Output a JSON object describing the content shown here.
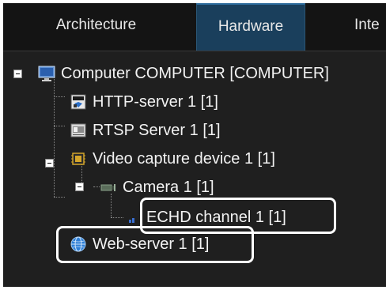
{
  "tabs": [
    {
      "label": "Architecture"
    },
    {
      "label": "Hardware"
    },
    {
      "label": "Inte"
    }
  ],
  "tree": {
    "computer": {
      "label": "Computer COMPUTER [COMPUTER]",
      "icon": "monitor-icon"
    },
    "http_server": {
      "label": "HTTP-server 1 [1]",
      "icon": "http-server-icon"
    },
    "rtsp_server": {
      "label": "RTSP Server 1 [1]",
      "icon": "rtsp-server-icon"
    },
    "video_capture": {
      "label": "Video capture device 1 [1]",
      "icon": "capture-chip-icon"
    },
    "camera": {
      "label": "Camera 1 [1]",
      "icon": "camera-icon"
    },
    "echd_channel": {
      "label": "ECHD channel 1 [1]",
      "icon": "channel-icon"
    },
    "web_server": {
      "label": "Web-server 1 [1]",
      "icon": "globe-icon"
    }
  },
  "colors": {
    "background": "#1f1f1f",
    "tabbar": "#141414",
    "active_tab": "#1a3f5c",
    "text": "#f2f2f2",
    "highlight": "#ffffff"
  }
}
